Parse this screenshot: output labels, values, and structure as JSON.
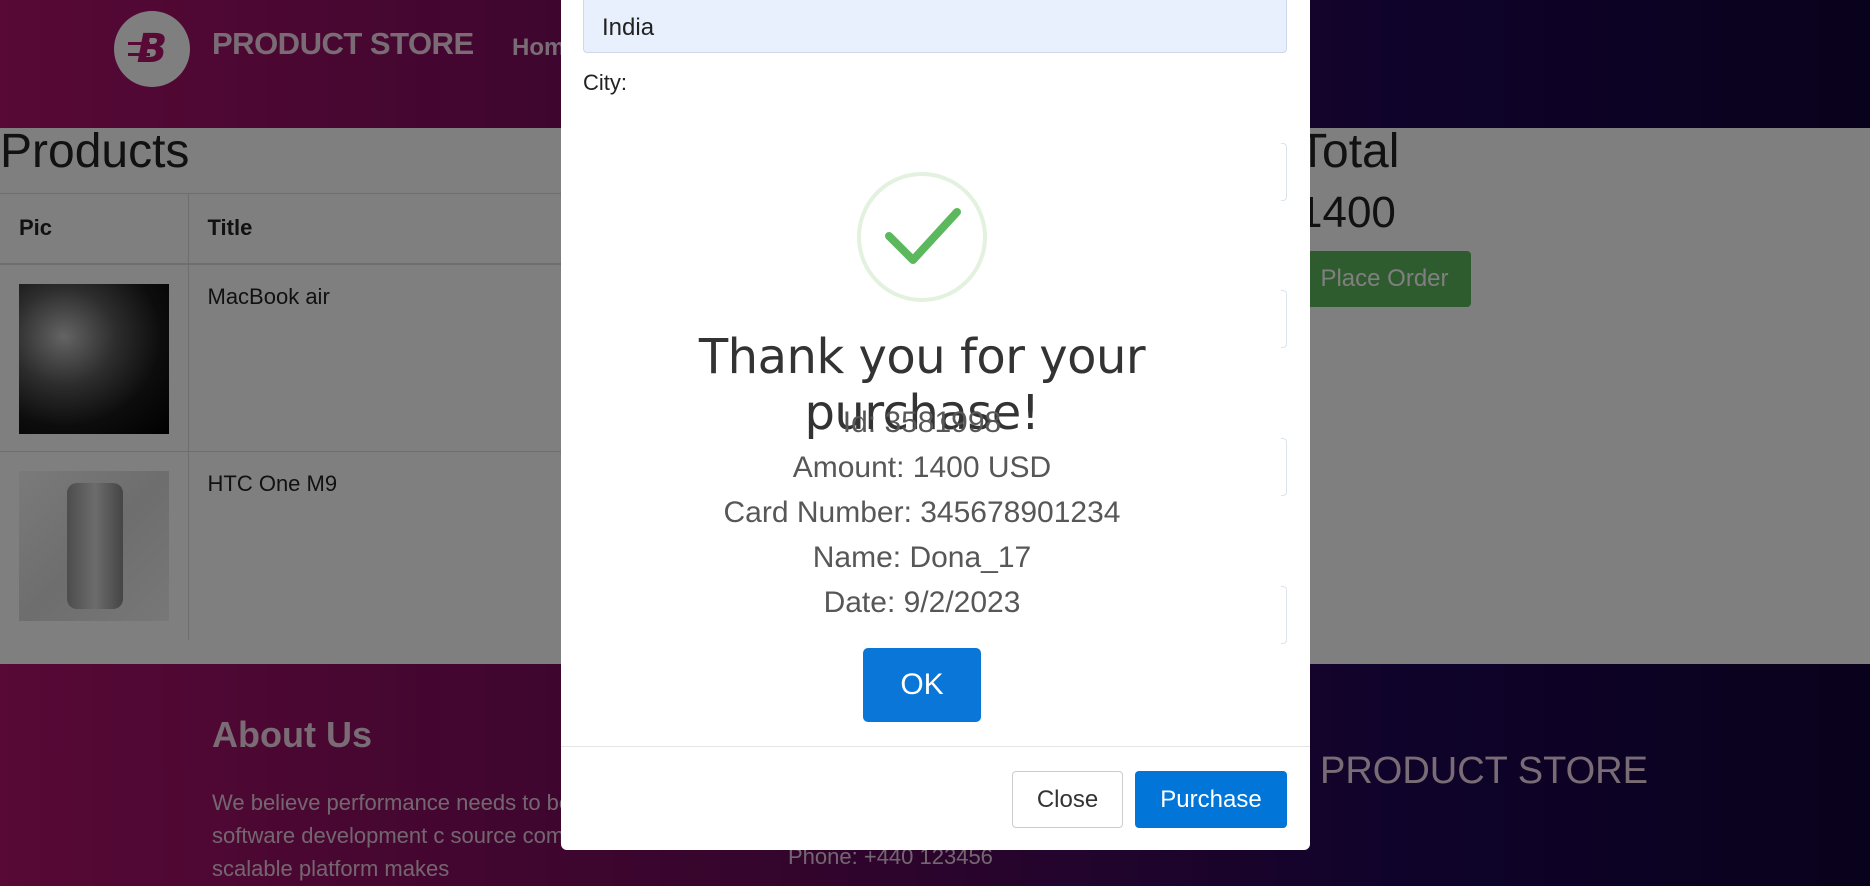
{
  "navbar": {
    "brand": "PRODUCT STORE",
    "logo_letter": "B",
    "home_label": "Hom"
  },
  "products": {
    "title": "Products",
    "columns": [
      "Pic",
      "Title"
    ],
    "rows": [
      {
        "title": "MacBook air"
      },
      {
        "title": "HTC One M9"
      }
    ]
  },
  "total": {
    "title": "Total",
    "value": "1400",
    "place_order_label": "Place Order"
  },
  "footer": {
    "about_title": "About Us",
    "about_text": "We believe performance needs to be stage of the software development c source compatible, massively scalable platform makes",
    "phone": "Phone: +440 123456",
    "brand": "PRODUCT STORE"
  },
  "modal": {
    "country_value": "India",
    "city_label": "City:",
    "close_label": "Close",
    "purchase_label": "Purchase"
  },
  "alert": {
    "title": "Thank you for your purchase!",
    "id_line": "Id: 3581998",
    "amount_line": "Amount: 1400 USD",
    "card_line": "Card Number: 345678901234",
    "name_line": "Name: Dona_17",
    "date_line": "Date: 9/2/2023",
    "ok_label": "OK"
  },
  "colors": {
    "accent_blue": "#0275d8",
    "success_green": "#5cb85c",
    "brand_magenta": "#b0126b",
    "brand_indigo": "#130438"
  },
  "icons": {
    "success": "checkmark-icon",
    "logo": "blazemeter-logo-icon"
  }
}
